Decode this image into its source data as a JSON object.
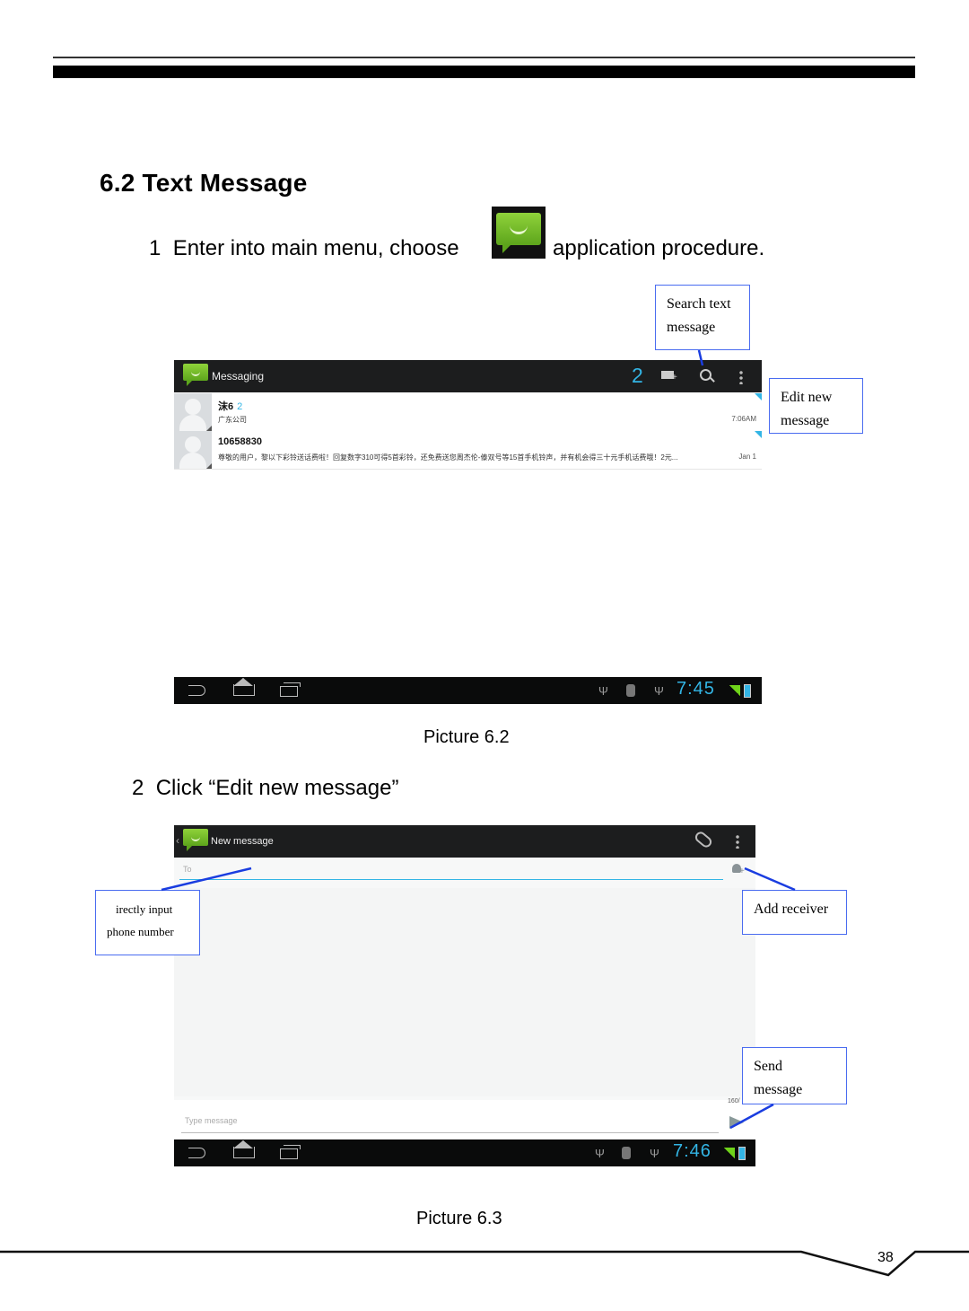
{
  "section": {
    "title": "6.2 Text Message"
  },
  "steps": [
    {
      "number": "1",
      "text_before": "Enter into main menu, choose",
      "icon": "messaging-app-icon",
      "text_after": "application procedure."
    },
    {
      "number": "2",
      "text": "Click “Edit new message”"
    }
  ],
  "picture_6_2": {
    "caption": "Picture 6.2",
    "action_bar": {
      "icon": "messaging-app-icon",
      "title": "Messaging",
      "unread_count": "2",
      "actions": [
        "compose-icon",
        "search-icon",
        "overflow-menu-icon"
      ]
    },
    "conversations": [
      {
        "name": "沫6",
        "count": "2",
        "snippet": "广东公司",
        "time": "7:06AM"
      },
      {
        "name": "10658830",
        "count": "",
        "snippet": "尊敬的用户，黎以下彩铃送话费啦！回复数字310可得5首彩铃，还免费送您周杰伦-傣双号等15首手机铃声，并有机会得三十元手机话费哦！2元...",
        "time": "Jan 1"
      }
    ],
    "nav_bar": {
      "clock": "7:45",
      "icons": [
        "back-icon",
        "home-icon",
        "recent-apps-icon",
        "usb-icon",
        "debug-icon",
        "usb-icon",
        "signal-icon",
        "battery-icon"
      ]
    },
    "callouts": {
      "search": "Search text message",
      "edit": "Edit new message"
    }
  },
  "picture_6_3": {
    "caption": "Picture 6.3",
    "action_bar": {
      "back": "‹",
      "icon": "messaging-app-icon",
      "title": "New message",
      "actions": [
        "attach-icon",
        "overflow-menu-icon"
      ]
    },
    "to_field": {
      "placeholder": "To"
    },
    "char_counter": "160/",
    "message_field": {
      "placeholder": "Type message"
    },
    "nav_bar": {
      "clock": "7:46"
    },
    "callouts": {
      "direct_input_line1": "irectly    input",
      "direct_input_line2": "phone number",
      "add_receiver": "Add receiver",
      "send_line1": "Send",
      "send_line2": "message"
    }
  },
  "footer": {
    "page_number": "38"
  }
}
